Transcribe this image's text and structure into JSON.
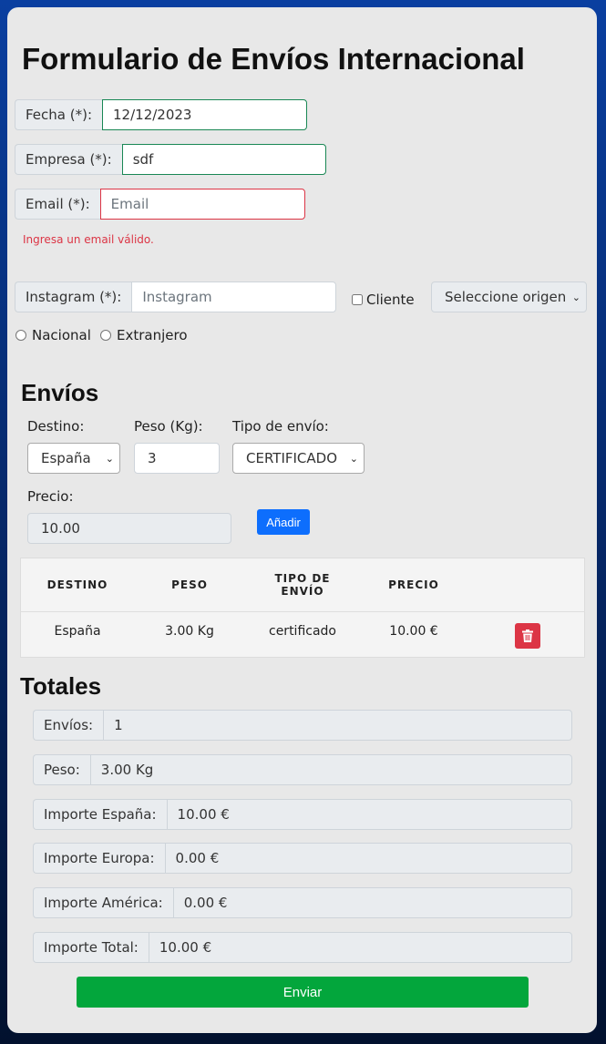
{
  "title": "Formulario de Envíos Internacional",
  "form": {
    "fecha": {
      "label": "Fecha (*):",
      "value": "12/12/2023"
    },
    "empresa": {
      "label": "Empresa (*):",
      "value": "sdf"
    },
    "email": {
      "label": "Email (*):",
      "placeholder": "Email",
      "error": "Ingresa un email válido."
    },
    "instagram": {
      "label": "Instagram (*):",
      "placeholder": "Instagram"
    },
    "cliente_label": "Cliente",
    "origen_select": "Seleccione origen",
    "radio_nacional": "Nacional",
    "radio_extranjero": "Extranjero"
  },
  "envios": {
    "heading": "Envíos",
    "destino_label": "Destino:",
    "destino_value": "España",
    "peso_label": "Peso (Kg):",
    "peso_value": "3",
    "tipo_label": "Tipo de envío:",
    "tipo_value": "CERTIFICADO",
    "precio_label": "Precio:",
    "precio_value": "10.00",
    "add_button": "Añadir"
  },
  "table": {
    "headers": [
      "DESTINO",
      "PESO",
      "TIPO DE ENVÍO",
      "PRECIO"
    ],
    "rows": [
      [
        "España",
        "3.00 Kg",
        "certificado",
        "10.00 €"
      ]
    ]
  },
  "totales": {
    "heading": "Totales",
    "items": [
      {
        "label": "Envíos:",
        "value": "1"
      },
      {
        "label": "Peso:",
        "value": "3.00 Kg"
      },
      {
        "label": "Importe España:",
        "value": "10.00 €"
      },
      {
        "label": "Importe Europa:",
        "value": "0.00 €"
      },
      {
        "label": "Importe América:",
        "value": "0.00 €"
      },
      {
        "label": "Importe Total:",
        "value": "10.00 €"
      }
    ]
  },
  "submit_button": "Enviar",
  "colors": {
    "primary": "#0d6efd",
    "danger": "#dc3545",
    "success": "#03a63c"
  }
}
